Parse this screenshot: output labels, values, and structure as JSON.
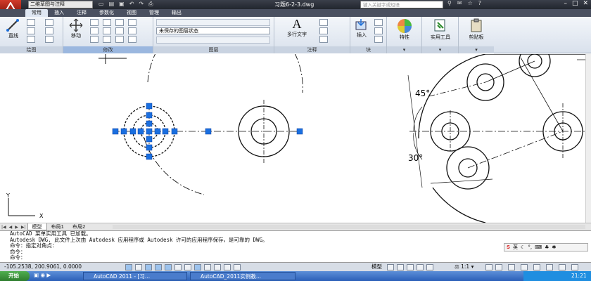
{
  "titlebar": {
    "workspace": "二维草图与注释",
    "doc_title": "习题6-2-3.dwg",
    "search_placeholder": "键入关键字或短语"
  },
  "ribbon_tabs": [
    "常用",
    "插入",
    "注释",
    "参数化",
    "视图",
    "管理",
    "输出"
  ],
  "ribbon": {
    "draw_line_label": "直线",
    "move_label": "移动",
    "layer_state": "未保存的图层状态",
    "text_label": "多行文字",
    "insert_label": "插入",
    "properties_label": "特性",
    "utilities_label": "实用工具",
    "clipboard_label": "剪贴板",
    "panels": {
      "draw": "绘图",
      "modify": "修改",
      "layers": "图层",
      "annotation": "注释",
      "block": "块"
    }
  },
  "drawing": {
    "angle_top": "45°",
    "angle_bottom": "30°",
    "axis_y": "Y",
    "axis_x": "X"
  },
  "layout_tabs": [
    "模型",
    "布局1",
    "布局2"
  ],
  "command_lines": [
    "AutoCAD 菜单实用工具 已加载。",
    "Autodesk DWG.  此文件上次由 Autodesk 应用程序或 Autodesk 许可的应用程序保存，是可靠的 DWG。",
    "命令：指定对角点：",
    "命令：",
    "命令："
  ],
  "ime": {
    "lang": "英"
  },
  "status": {
    "coords": "-105.2538, 200.9061, 0.0000",
    "model": "模型",
    "scale": "1:1"
  },
  "taskbar": {
    "start": "开始",
    "task1": "AutoCAD 2011 - [习...",
    "task2": "AutoCAD_2011实例教...",
    "time": "21:21"
  },
  "colors": {
    "accent": "#1e6fd9",
    "grip": "#1a6fe0",
    "titlebar": "#2e333d"
  }
}
